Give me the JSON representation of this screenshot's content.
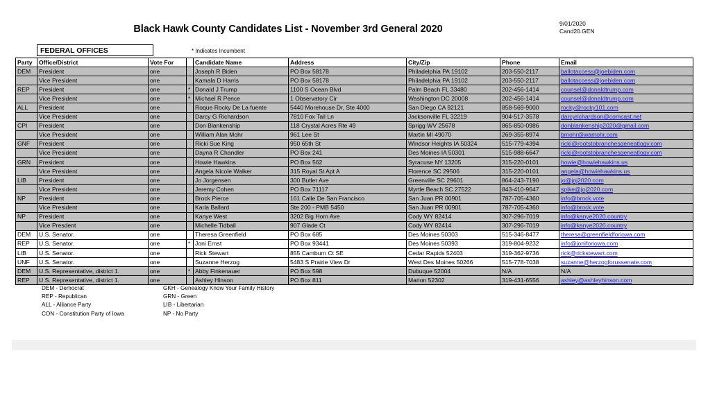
{
  "document": {
    "title": "Black Hawk County Candidates List - November 3rd General 2020",
    "date": "9/01/2020",
    "file_id": "Cand20.GEN",
    "section_label": "FEDERAL OFFICES",
    "incumbent_note": "* Indicates Incumbent"
  },
  "table": {
    "columns": [
      "Party",
      "Office/District",
      "Vote For",
      "",
      "Candidate Name",
      "Address",
      "City/Zip",
      "Phone",
      "Email"
    ],
    "rows": [
      {
        "party": "DEM",
        "office": "President",
        "vote_for": "one",
        "star": "",
        "name": "Joseph R Biden",
        "address": "PO Box 58178",
        "city_zip": "Philadelphia PA 19102",
        "phone": "203-550-2117",
        "email": "ballotaccess@joebiden.com",
        "shade": true,
        "group_top": false,
        "group_bottom": false
      },
      {
        "party": "",
        "office": "Vice President",
        "vote_for": "one",
        "star": "",
        "name": "Kamala D Harris",
        "address": "PO Box 58178",
        "city_zip": "Philadelphia PA 19102",
        "phone": "203-550-2117",
        "email": "ballotaccess@joebiden.com",
        "shade": true,
        "group_top": false,
        "group_bottom": false
      },
      {
        "party": "REP",
        "office": "President",
        "vote_for": "one",
        "star": "*",
        "name": "Donald J Trump",
        "address": "1100 S Ocean Blvd",
        "city_zip": "Palm Beach FL 33480",
        "phone": "202-456-1414",
        "email": "counsel@donaldtrump.com",
        "shade": true,
        "group_top": false,
        "group_bottom": false
      },
      {
        "party": "",
        "office": "Vice President",
        "vote_for": "one",
        "star": "*",
        "name": "Michael R Pence",
        "address": "1 Observatory Cir",
        "city_zip": "Washington DC 20008",
        "phone": "202-456-1414",
        "email": "counsel@donaldtrump.com",
        "shade": true,
        "group_top": false,
        "group_bottom": false
      },
      {
        "party": "ALL",
        "office": "President",
        "vote_for": "one",
        "star": "",
        "name": "Roque Rocky De La fuente",
        "address": "5440 Morehouse Dr, Ste 4000",
        "city_zip": "San Diego CA 92121",
        "phone": "858-569-9000",
        "email": "rocky@rocky101.com",
        "shade": true,
        "group_top": false,
        "group_bottom": false
      },
      {
        "party": "",
        "office": "Vice President",
        "vote_for": "one",
        "star": "",
        "name": "Darcy G Richardson",
        "address": "7810 Fox Tail Ln",
        "city_zip": "Jacksonville FL 32219",
        "phone": "904-517-3578",
        "email": "darcyrichardson@comcast.net",
        "shade": true,
        "group_top": false,
        "group_bottom": false
      },
      {
        "party": "CPI",
        "office": "President",
        "vote_for": "one",
        "star": "",
        "name": "Don Blankenship",
        "address": "118 Crystal Acres Rte 49",
        "city_zip": "Sprigg WV 25678",
        "phone": "865-850-0986",
        "email": "donblankenship2020@gmail.com",
        "shade": true,
        "group_top": false,
        "group_bottom": false
      },
      {
        "party": "",
        "office": "Vice President",
        "vote_for": "one",
        "star": "",
        "name": "William Alan Mohr",
        "address": "961 Lee St",
        "city_zip": "Martin MI 49070",
        "phone": "269-355-8974",
        "email": "bmohr@wamohr.com",
        "shade": true,
        "group_top": false,
        "group_bottom": false
      },
      {
        "party": "GNF",
        "office": "President",
        "vote_for": "one",
        "star": "",
        "name": "Ricki Sue King",
        "address": "950 65th St",
        "city_zip": "Windsor Heights IA 50324",
        "phone": "515-779-4394",
        "email": "ricki@rootstobranchesgeneatlogy.com",
        "shade": true,
        "group_top": false,
        "group_bottom": false
      },
      {
        "party": "",
        "office": "Vice President",
        "vote_for": "one",
        "star": "",
        "name": "Dayna R Chandler",
        "address": "PO Box 241",
        "city_zip": "Des Moines IA 50301",
        "phone": "515-988-6647",
        "email": "ricki@rootstobranchesgeneatlogy.com",
        "shade": true,
        "group_top": false,
        "group_bottom": false
      },
      {
        "party": "GRN",
        "office": "President",
        "vote_for": "one",
        "star": "",
        "name": "Howie Hawkins",
        "address": "PO Box 562",
        "city_zip": "Syracuse NY 13205",
        "phone": "315-220-0101",
        "email": "howie@howiehawkins.us",
        "shade": true,
        "group_top": false,
        "group_bottom": false
      },
      {
        "party": "",
        "office": "Vice President",
        "vote_for": "one",
        "star": "",
        "name": "Angela Nicole Walker",
        "address": "315 Royal St Apt A",
        "city_zip": "Florence SC 29506",
        "phone": "315-220-0101",
        "email": "angela@howiehawkins.us",
        "shade": true,
        "group_top": false,
        "group_bottom": false
      },
      {
        "party": "LIB",
        "office": "President",
        "vote_for": "one",
        "star": "",
        "name": "Jo Jorgensen",
        "address": "300 Butler Ave",
        "city_zip": "Greenville SC 29601",
        "phone": "864-243-7190",
        "email": "jo@joj2020.com",
        "shade": true,
        "group_top": false,
        "group_bottom": false
      },
      {
        "party": "",
        "office": "Vice President",
        "vote_for": "one",
        "star": "",
        "name": "Jeremy Cohen",
        "address": "PO Box 71117",
        "city_zip": "Myrtle Beach SC 27522",
        "phone": "843-410-9647",
        "email": "spike@joj2020.com",
        "shade": true,
        "group_top": false,
        "group_bottom": false
      },
      {
        "party": "NP",
        "office": "President",
        "vote_for": "one",
        "star": "",
        "name": "Brock Pierce",
        "address": "161 Calle De San Francisco",
        "city_zip": "San Juan PR 00901",
        "phone": "787-705-4360",
        "email": "info@brock.vote",
        "shade": true,
        "group_top": false,
        "group_bottom": false
      },
      {
        "party": "",
        "office": "Vice President",
        "vote_for": "one",
        "star": "",
        "name": "Karla Ballard",
        "address": "Ste 200 - PMB 5450",
        "city_zip": "San Juan PR 00901",
        "phone": "787-705-4360",
        "email": "info@brock.vote",
        "shade": true,
        "group_top": false,
        "group_bottom": false
      },
      {
        "party": "NP",
        "office": "President",
        "vote_for": "one",
        "star": "",
        "name": "Kanye West",
        "address": "3202 Big Horn Ave",
        "city_zip": "Cody WY 82414",
        "phone": "307-296-7019",
        "email": "info@kanye2020.country",
        "shade": true,
        "group_top": false,
        "group_bottom": false
      },
      {
        "party": "",
        "office": "Vice Presdent",
        "vote_for": "one",
        "star": "",
        "name": "Michelle Tidball",
        "address": "907 Glade Ct",
        "city_zip": "Cody WY 82414",
        "phone": "307-296-7019",
        "email": "info@kanye2020.country",
        "shade": true,
        "group_top": false,
        "group_bottom": true
      },
      {
        "party": "DEM",
        "office": "U.S. Senator.",
        "vote_for": "one",
        "star": "",
        "name": "Theresa Greenfield",
        "address": "PO Box 685",
        "city_zip": "Des Moines 50303",
        "phone": "515-346-8477",
        "email": "theresa@greenfieldforiowa.com",
        "shade": false,
        "group_top": true,
        "group_bottom": false
      },
      {
        "party": "REP",
        "office": "U.S. Senator.",
        "vote_for": "one",
        "star": "*",
        "name": "Joni Ernst",
        "address": "PO Box 93441",
        "city_zip": "Des Moines 50393",
        "phone": "319-804-9232",
        "email": "info@joniforiowa.com",
        "shade": false,
        "group_top": false,
        "group_bottom": false
      },
      {
        "party": "LIB",
        "office": "U.S. Senator.",
        "vote_for": "one",
        "star": "",
        "name": "Rick Stewart",
        "address": "855 Camburn Ct SE",
        "city_zip": "Cedar Rapids 52403",
        "phone": "319-362-9736",
        "email": "rick@rickstewart.com",
        "shade": false,
        "group_top": false,
        "group_bottom": false
      },
      {
        "party": "UNF",
        "office": "U.S. Senator.",
        "vote_for": "one",
        "star": "",
        "name": "Suzanne Herzog",
        "address": "5483 S Prairie View Dr",
        "city_zip": "West Des Moines 50266",
        "phone": "515-778-7038",
        "email": "suzanne@herzogforussenate.com",
        "shade": false,
        "group_top": false,
        "group_bottom": true
      },
      {
        "party": "DEM",
        "office": "U.S. Representative, district 1.",
        "vote_for": "one",
        "star": "*",
        "name": "Abby Finkenauer",
        "address": "PO Box 598",
        "city_zip": "Dubuque 52004",
        "phone": "N/A",
        "email": "N/A",
        "shade": true,
        "group_top": true,
        "group_bottom": false
      },
      {
        "party": "REP",
        "office": "U.S. Representative, district 1.",
        "vote_for": "one",
        "star": "",
        "name": "Ashley Hinson",
        "address": "PO Box 811",
        "city_zip": "Marion 52302",
        "phone": "319-431-6556",
        "email": "ashley@ashleyhinson.com ",
        "shade": true,
        "group_top": false,
        "group_bottom": true
      }
    ]
  },
  "legend": {
    "column_a": [
      "DEM - Democrat",
      "REP - Republican",
      "ALL - Alliance Party",
      "CON - Constitution Party of Iowa"
    ],
    "column_b": [
      "GKH - Genealogy Know Your Family History",
      "GRN - Green",
      "LIB - Libertarian",
      "NP - No Party"
    ]
  },
  "colors": {
    "row_shade": "#c0c0c0",
    "link": "#2020d0",
    "band": "#f0f0f0"
  }
}
